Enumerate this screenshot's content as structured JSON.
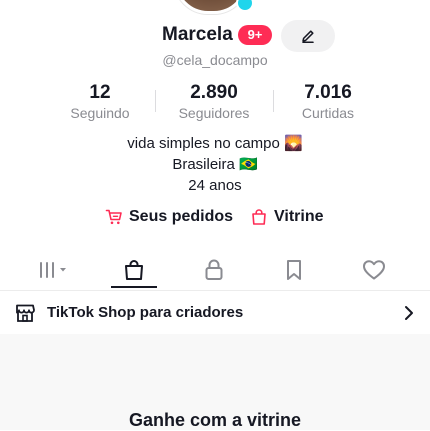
{
  "profile": {
    "name": "Marcela",
    "notification_badge": "9+",
    "handle": "@cela_docampo"
  },
  "stats": [
    {
      "value": "12",
      "label": "Seguindo"
    },
    {
      "value": "2.890",
      "label": "Seguidores"
    },
    {
      "value": "7.016",
      "label": "Curtidas"
    }
  ],
  "bio": {
    "line1": "vida simples no campo 🌄",
    "line2": "Brasileira 🇧🇷",
    "line3": "24 anos"
  },
  "actions": {
    "orders_label": "Seus pedidos",
    "showcase_label": "Vitrine"
  },
  "tabs": [
    {
      "icon": "grid-icon",
      "selected": false
    },
    {
      "icon": "shopping-bag-icon",
      "selected": true
    },
    {
      "icon": "lock-icon",
      "selected": false
    },
    {
      "icon": "bookmark-icon",
      "selected": false
    },
    {
      "icon": "heart-icon",
      "selected": false
    }
  ],
  "shop_banner": {
    "label": "TikTok Shop para criadores"
  },
  "earn": {
    "title": "Ganhe com a vitrine"
  },
  "colors": {
    "accent": "#fe2c55",
    "text": "#161823",
    "secondary_text": "#8a8b91",
    "avatar_plus": "#20d5ec"
  }
}
